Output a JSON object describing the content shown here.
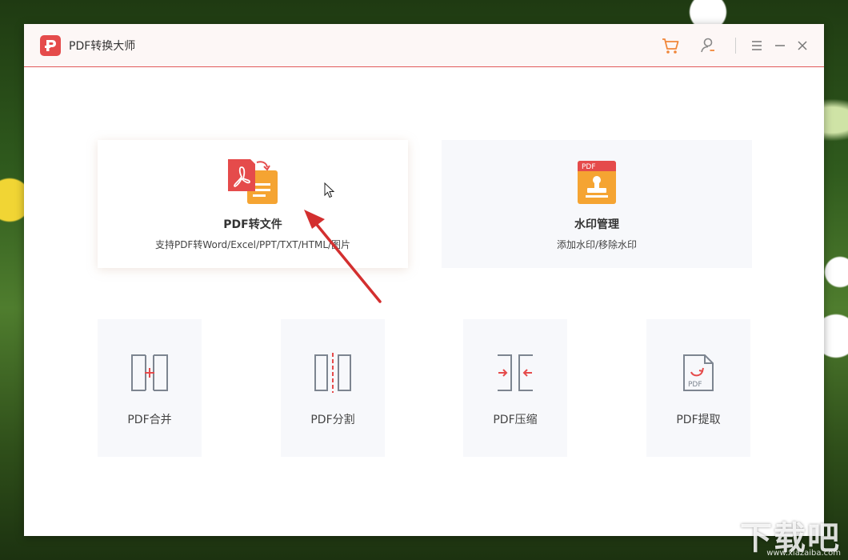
{
  "window": {
    "title": "PDF转换大师"
  },
  "toolbar": {
    "cart_icon": "cart-icon",
    "user_icon": "user-icon",
    "menu_icon": "menu-icon",
    "minimize_icon": "minimize-icon",
    "close_icon": "close-icon"
  },
  "features": [
    {
      "title": "PDF转文件",
      "description": "支持PDF转Word/Excel/PPT/TXT/HTML/图片",
      "icon": "pdf-convert-icon"
    },
    {
      "title": "水印管理",
      "description": "添加水印/移除水印",
      "icon": "watermark-stamp-icon"
    }
  ],
  "tools": [
    {
      "label": "PDF合并",
      "icon": "merge-icon"
    },
    {
      "label": "PDF分割",
      "icon": "split-icon"
    },
    {
      "label": "PDF压缩",
      "icon": "compress-icon"
    },
    {
      "label": "PDF提取",
      "icon": "extract-icon"
    }
  ],
  "watermark_logo": {
    "text": "下载吧",
    "url": "www.xiazaiba.com"
  },
  "colors": {
    "accent": "#e54b4b",
    "orange": "#f5a432",
    "icon_gray": "#7d8590",
    "card_bg": "#f7f8fb"
  }
}
